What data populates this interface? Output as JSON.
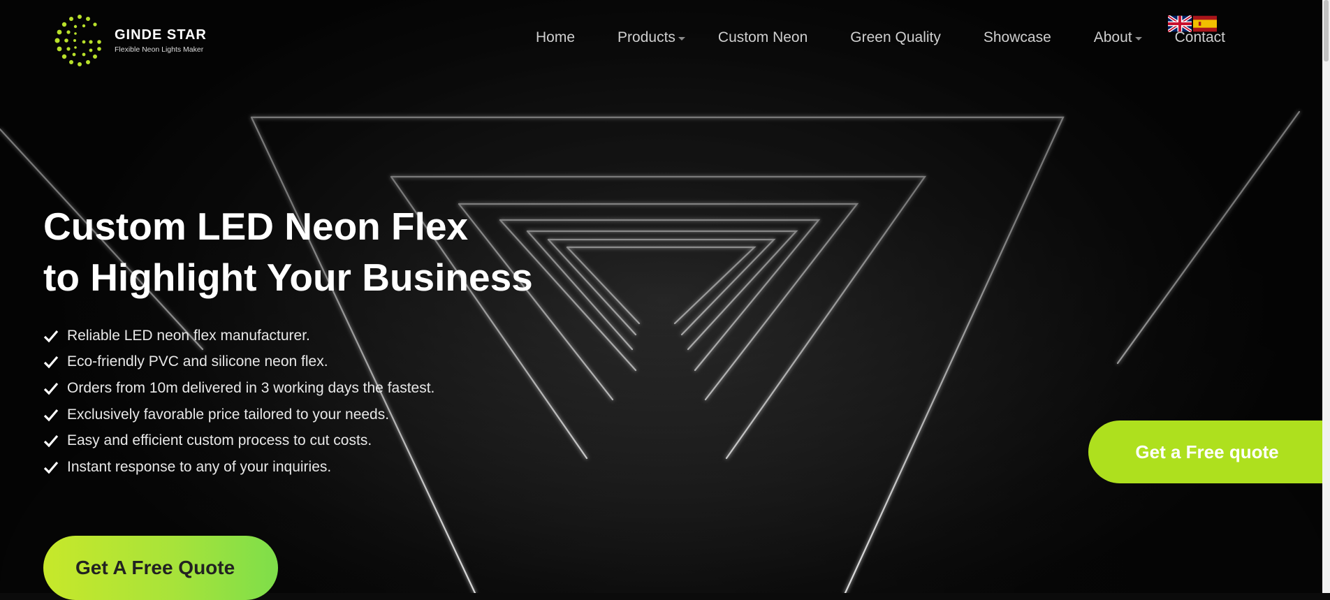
{
  "brand": {
    "name": "GINDE STAR",
    "tagline": "Flexible Neon Lights Maker"
  },
  "nav": {
    "items": [
      {
        "label": "Home",
        "has_dropdown": false
      },
      {
        "label": "Products",
        "has_dropdown": true
      },
      {
        "label": "Custom Neon",
        "has_dropdown": false
      },
      {
        "label": "Green Quality",
        "has_dropdown": false
      },
      {
        "label": "Showcase",
        "has_dropdown": false
      },
      {
        "label": "About",
        "has_dropdown": true
      },
      {
        "label": "Contact",
        "has_dropdown": false
      }
    ]
  },
  "languages": [
    {
      "icon": "uk-flag-icon"
    },
    {
      "icon": "spain-flag-icon"
    }
  ],
  "hero": {
    "headline_line1": "Custom LED Neon Flex",
    "headline_line2": "to Highlight Your Business",
    "features": [
      "Reliable LED neon flex manufacturer.",
      "Eco-friendly PVC and silicone neon flex.",
      "Orders from 10m delivered in 3 working days the fastest.",
      "Exclusively favorable price tailored to your needs.",
      "Easy and efficient custom process to cut costs.",
      "Instant response to any of your inquiries."
    ],
    "cta_label": "Get A Free Quote"
  },
  "floating_quote_label": "Get a Free quote",
  "colors": {
    "accent_green": "#aee01e",
    "background": "#0b0b0b",
    "text": "#ffffff"
  }
}
